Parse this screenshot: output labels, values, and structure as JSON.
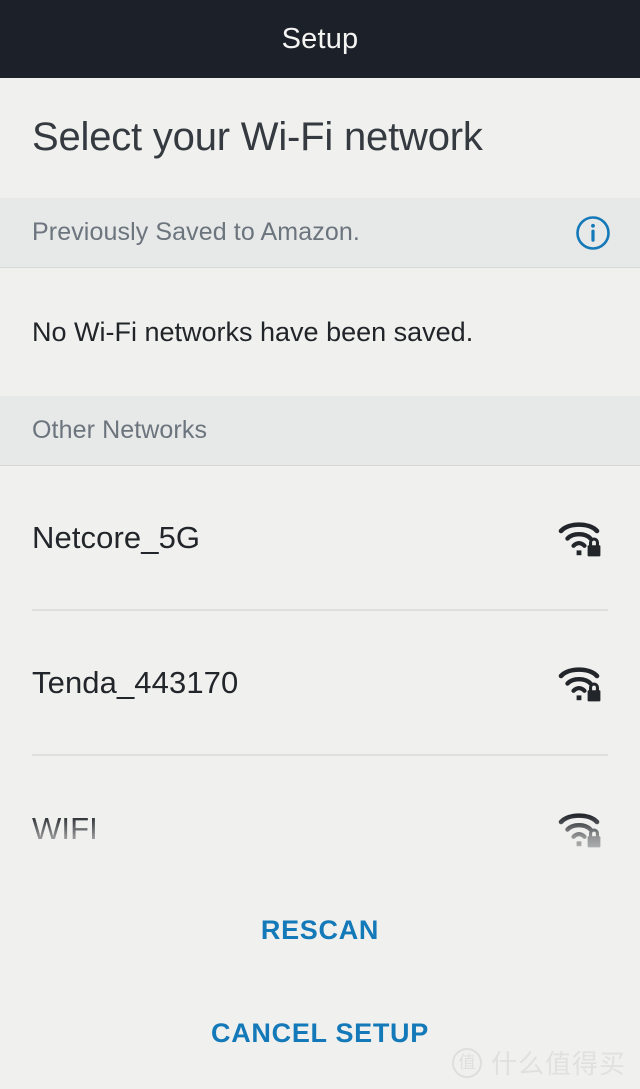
{
  "titlebar": {
    "title": "Setup"
  },
  "page": {
    "heading": "Select your Wi-Fi network"
  },
  "saved_section": {
    "label": "Previously Saved to Amazon.",
    "info_icon": "info-circle-icon",
    "empty_message": "No Wi-Fi networks have been saved."
  },
  "other_section": {
    "label": "Other Networks",
    "networks": [
      {
        "ssid": "Netcore_5G",
        "signal_icon": "wifi-secured-icon",
        "secured": true
      },
      {
        "ssid": "Tenda_443170",
        "signal_icon": "wifi-secured-icon",
        "secured": true
      },
      {
        "ssid": "WIFI",
        "signal_icon": "wifi-secured-icon",
        "secured": true
      }
    ]
  },
  "footer": {
    "rescan_label": "RESCAN",
    "cancel_label": "CANCEL SETUP"
  },
  "watermark": {
    "logo_char": "值",
    "text": "什么值得买"
  },
  "colors": {
    "titlebar_bg": "#1c2129",
    "page_bg": "#f0f0ee",
    "band_bg": "#e7e8e8",
    "accent_blue": "#1479b8",
    "heading_text": "#343a40",
    "muted_text": "#6c757d",
    "divider": "#dedfdf"
  }
}
